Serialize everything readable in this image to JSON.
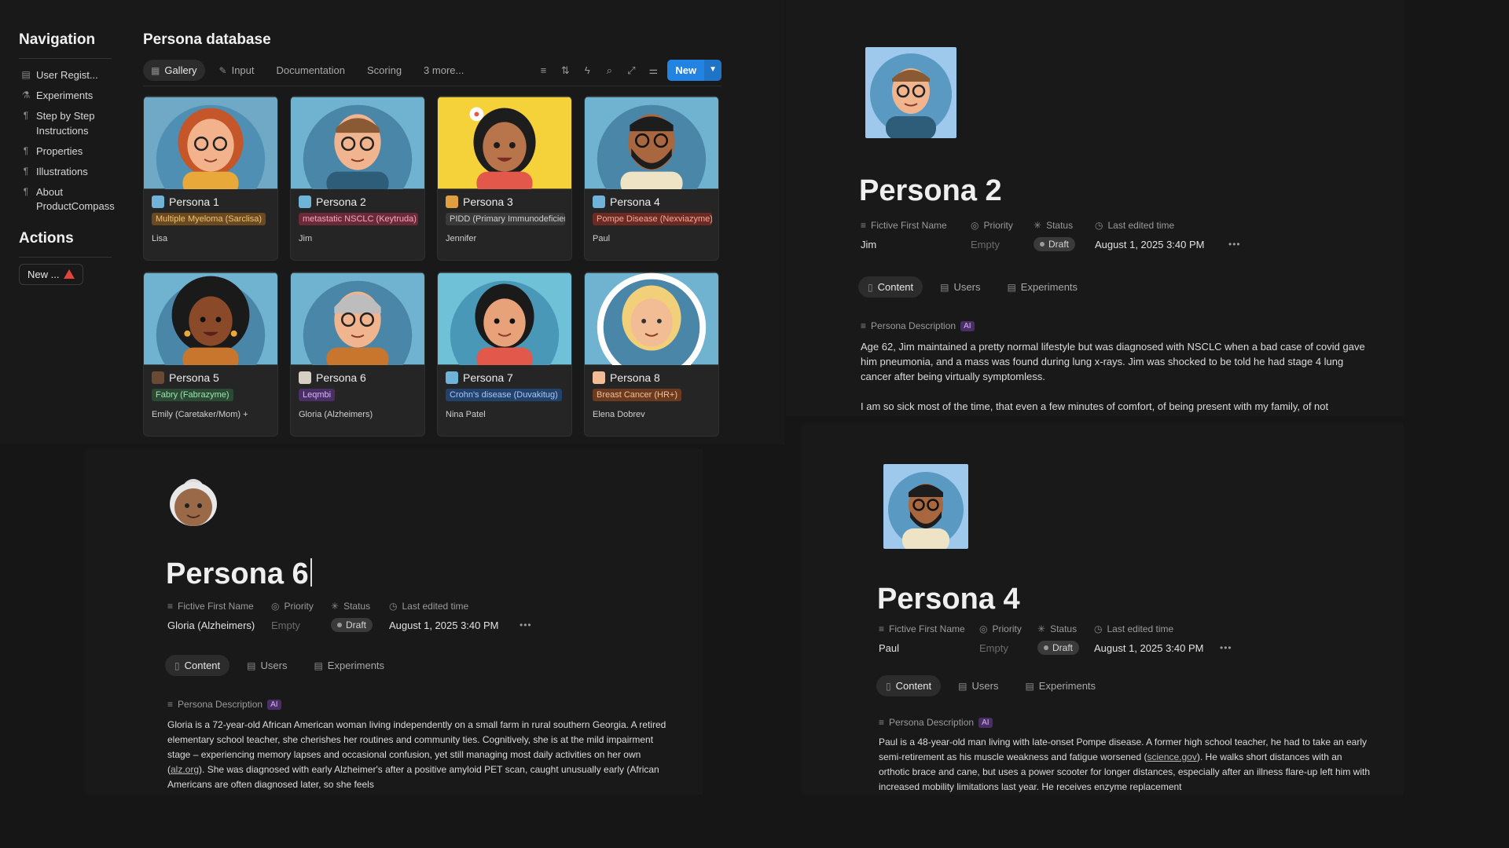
{
  "navigation": {
    "title": "Navigation",
    "items": [
      {
        "label": "User Regist...",
        "icon": "id-card-icon"
      },
      {
        "label": "Experiments",
        "icon": "flask-icon"
      },
      {
        "label": "Step by Step Instructions",
        "icon": "pilcrow-icon"
      },
      {
        "label": "Properties",
        "icon": "pilcrow-icon"
      },
      {
        "label": "Illustrations",
        "icon": "pilcrow-icon"
      },
      {
        "label": "About ProductCompass",
        "icon": "pilcrow-icon"
      }
    ],
    "actions_title": "Actions",
    "new_label": "New ..."
  },
  "database": {
    "title": "Persona database",
    "tabs": [
      "Gallery",
      "Input",
      "Documentation",
      "Scoring",
      "3 more..."
    ],
    "new_button": "New",
    "cards": [
      {
        "title": "Persona 1",
        "tag": "Multiple Myeloma (Sarclisa)",
        "tag_color": "#6b4a1f",
        "tag_text": "#f0c27a",
        "name": "Lisa"
      },
      {
        "title": "Persona 2",
        "tag": "metastatic NSCLC (Keytruda)",
        "tag_color": "#6b2a3a",
        "tag_text": "#f4a7b9",
        "name": "Jim"
      },
      {
        "title": "Persona 3",
        "tag": "PIDD (Primary Immunodeficiency)",
        "tag_color": "#3a3a3a",
        "tag_text": "#d0d0d0",
        "name": "Jennifer"
      },
      {
        "title": "Persona 4",
        "tag": "Pompe Disease (Nexviazyme)",
        "tag_color": "#6b2a22",
        "tag_text": "#f5a99a",
        "name": "Paul"
      },
      {
        "title": "Persona 5",
        "tag": "Fabry (Fabrazyme)",
        "tag_color": "#2b4a33",
        "tag_text": "#9fe0b0",
        "name": "Emily (Caretaker/Mom) +"
      },
      {
        "title": "Persona 6",
        "tag": "Leqmbi",
        "tag_color": "#4a2e66",
        "tag_text": "#d7b6f5",
        "name": "Gloria (Alzheimers)"
      },
      {
        "title": "Persona 7",
        "tag": "Crohn's disease (Duvakitug)",
        "tag_color": "#22416b",
        "tag_text": "#a8c8f5",
        "name": "Nina Patel"
      },
      {
        "title": "Persona 8",
        "tag": "Breast Cancer (HR+)",
        "tag_color": "#6b3a1f",
        "tag_text": "#f5bf95",
        "name": "Elena Dobrev"
      }
    ]
  },
  "labels": {
    "first_name": "Fictive First Name",
    "priority": "Priority",
    "status": "Status",
    "last_edited": "Last edited time",
    "empty": "Empty",
    "draft": "Draft",
    "tab_content": "Content",
    "tab_users": "Users",
    "tab_experiments": "Experiments",
    "persona_description": "Persona Description",
    "ai": "AI"
  },
  "persona2": {
    "title": "Persona 2",
    "first_name": "Jim",
    "last_edited": "August 1, 2025 3:40 PM",
    "description_1": "Age 62, Jim maintained a pretty normal lifestyle but was diagnosed with NSCLC when a bad case of covid gave him pneumonia, and a mass was found during lung x-rays. Jim was shocked to be told he had stage 4 lung cancer after being virtually symptomless.",
    "description_2": "I am so sick most of the time, that even a few minutes of comfort, of being present with my family, of not"
  },
  "persona4": {
    "title": "Persona 4",
    "first_name": "Paul",
    "last_edited": "August 1, 2025 3:40 PM",
    "description_a": "Paul is a 48-year-old man living with late-onset Pompe disease. A former high school teacher, he had to take an early semi-retirement as his muscle weakness and fatigue worsened (",
    "link": "science.gov",
    "description_b": "). He walks short distances with an orthotic brace and cane, but uses a power scooter for longer distances, especially after an illness flare-up left him with increased mobility limitations last year. He receives enzyme replacement"
  },
  "persona6": {
    "title": "Persona 6",
    "first_name": "Gloria (Alzheimers)",
    "last_edited": "August 1, 2025 3:40 PM",
    "description_a": "Gloria is a 72-year-old African American woman living independently on a small farm in rural southern Georgia. A retired elementary school teacher, she cherishes her routines and community ties. Cognitively, she is at the mild impairment stage – experiencing memory lapses and occasional confusion, yet still managing most daily activities on her own (",
    "link": "alz.org",
    "description_b": "). She was diagnosed with early Alzheimer's after a positive amyloid PET scan, caught unusually early (African Americans are often diagnosed later, so she feels"
  }
}
